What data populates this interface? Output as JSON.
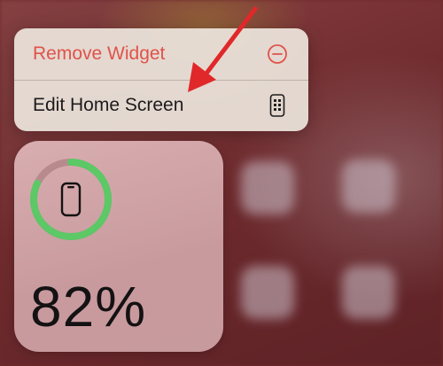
{
  "context_menu": {
    "remove_widget_label": "Remove Widget",
    "edit_home_screen_label": "Edit Home Screen"
  },
  "battery_widget": {
    "percentage_text": "82%",
    "level": 0.82,
    "ring_color": "#5cc866",
    "track_color": "#b88a8e"
  },
  "colors": {
    "destructive": "#e0534a",
    "annotation_arrow": "#e0282a"
  },
  "icons": [
    "minus-circle-icon",
    "phone-grid-icon",
    "iphone-icon",
    "annotation-arrow-icon"
  ]
}
